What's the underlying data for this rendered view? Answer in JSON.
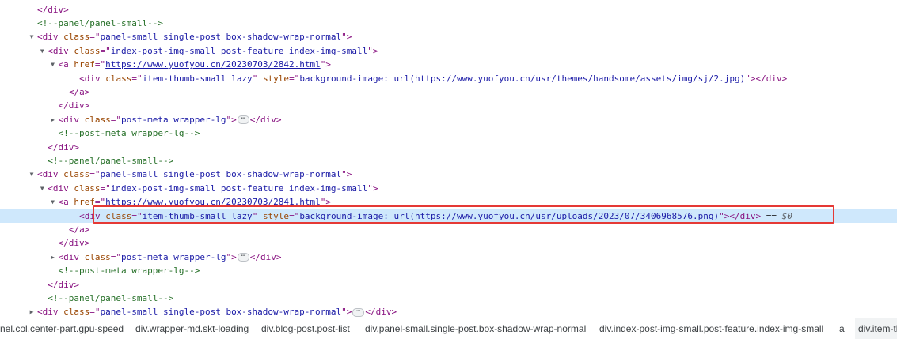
{
  "lines": [
    {
      "ind": 6,
      "tri": "",
      "tokens": [
        {
          "t": "tag",
          "v": "</div>"
        }
      ]
    },
    {
      "ind": 6,
      "tri": "",
      "tokens": [
        {
          "t": "cmt",
          "v": "<!--panel/panel-small-->"
        }
      ]
    },
    {
      "ind": 6,
      "tri": "open",
      "tokens": [
        {
          "t": "tag",
          "v": "<div "
        },
        {
          "t": "attr",
          "v": "class"
        },
        {
          "t": "tag",
          "v": "=\""
        },
        {
          "t": "val",
          "v": "panel-small single-post box-shadow-wrap-normal"
        },
        {
          "t": "tag",
          "v": "\">"
        }
      ]
    },
    {
      "ind": 8,
      "tri": "open",
      "tokens": [
        {
          "t": "tag",
          "v": "<div "
        },
        {
          "t": "attr",
          "v": "class"
        },
        {
          "t": "tag",
          "v": "=\""
        },
        {
          "t": "val",
          "v": "index-post-img-small post-feature index-img-small"
        },
        {
          "t": "tag",
          "v": "\">"
        }
      ]
    },
    {
      "ind": 10,
      "tri": "open",
      "tokens": [
        {
          "t": "tag",
          "v": "<a "
        },
        {
          "t": "attr",
          "v": "href"
        },
        {
          "t": "tag",
          "v": "=\""
        },
        {
          "t": "link",
          "v": "https://www.yuofyou.cn/20230703/2842.html"
        },
        {
          "t": "tag",
          "v": "\">"
        }
      ]
    },
    {
      "ind": 14,
      "tri": "",
      "tokens": [
        {
          "t": "tag",
          "v": "<div "
        },
        {
          "t": "attr",
          "v": "class"
        },
        {
          "t": "tag",
          "v": "=\""
        },
        {
          "t": "val",
          "v": "item-thumb-small lazy"
        },
        {
          "t": "tag",
          "v": "\" "
        },
        {
          "t": "attr",
          "v": "style"
        },
        {
          "t": "tag",
          "v": "=\""
        },
        {
          "t": "val",
          "v": "background-image: url(https://www.yuofyou.cn/usr/themes/handsome/assets/img/sj/2.jpg)"
        },
        {
          "t": "tag",
          "v": "\"></div>"
        }
      ]
    },
    {
      "ind": 12,
      "tri": "",
      "tokens": [
        {
          "t": "tag",
          "v": "</a>"
        }
      ]
    },
    {
      "ind": 10,
      "tri": "",
      "tokens": [
        {
          "t": "tag",
          "v": "</div>"
        }
      ]
    },
    {
      "ind": 10,
      "tri": "closed",
      "tokens": [
        {
          "t": "tag",
          "v": "<div "
        },
        {
          "t": "attr",
          "v": "class"
        },
        {
          "t": "tag",
          "v": "=\""
        },
        {
          "t": "val",
          "v": "post-meta wrapper-lg"
        },
        {
          "t": "tag",
          "v": "\">"
        },
        {
          "t": "ellipsis",
          "v": "⋯"
        },
        {
          "t": "tag",
          "v": "</div>"
        }
      ]
    },
    {
      "ind": 10,
      "tri": "",
      "tokens": [
        {
          "t": "cmt",
          "v": "<!--post-meta wrapper-lg-->"
        }
      ]
    },
    {
      "ind": 8,
      "tri": "",
      "tokens": [
        {
          "t": "tag",
          "v": "</div>"
        }
      ]
    },
    {
      "ind": 8,
      "tri": "",
      "tokens": [
        {
          "t": "cmt",
          "v": "<!--panel/panel-small-->"
        }
      ]
    },
    {
      "ind": 6,
      "tri": "open",
      "tokens": [
        {
          "t": "tag",
          "v": "<div "
        },
        {
          "t": "attr",
          "v": "class"
        },
        {
          "t": "tag",
          "v": "=\""
        },
        {
          "t": "val",
          "v": "panel-small single-post box-shadow-wrap-normal"
        },
        {
          "t": "tag",
          "v": "\">"
        }
      ]
    },
    {
      "ind": 8,
      "tri": "open",
      "tokens": [
        {
          "t": "tag",
          "v": "<div "
        },
        {
          "t": "attr",
          "v": "class"
        },
        {
          "t": "tag",
          "v": "=\""
        },
        {
          "t": "val",
          "v": "index-post-img-small post-feature index-img-small"
        },
        {
          "t": "tag",
          "v": "\">"
        }
      ]
    },
    {
      "ind": 10,
      "tri": "open",
      "tokens": [
        {
          "t": "tag",
          "v": "<a "
        },
        {
          "t": "attr",
          "v": "href"
        },
        {
          "t": "tag",
          "v": "=\""
        },
        {
          "t": "link",
          "v": "https://www.yuofyou.cn/20230703/2841.html"
        },
        {
          "t": "tag",
          "v": "\">"
        }
      ]
    },
    {
      "ind": 14,
      "tri": "",
      "selected": true,
      "tokens": [
        {
          "t": "tag",
          "v": "<div "
        },
        {
          "t": "attr",
          "v": "class"
        },
        {
          "t": "tag",
          "v": "=\""
        },
        {
          "t": "val",
          "v": "item-thumb-small lazy"
        },
        {
          "t": "tag",
          "v": "\" "
        },
        {
          "t": "attr",
          "v": "style"
        },
        {
          "t": "tag",
          "v": "=\""
        },
        {
          "t": "val",
          "v": "background-image: url(https://www.yuofyou.cn/usr/uploads/2023/07/3406968576.png)"
        },
        {
          "t": "tag",
          "v": "\"></div>"
        },
        {
          "t": "eq",
          "v": " == "
        },
        {
          "t": "dollar",
          "v": "$0"
        }
      ]
    },
    {
      "ind": 12,
      "tri": "",
      "tokens": [
        {
          "t": "tag",
          "v": "</a>"
        }
      ]
    },
    {
      "ind": 10,
      "tri": "",
      "tokens": [
        {
          "t": "tag",
          "v": "</div>"
        }
      ]
    },
    {
      "ind": 10,
      "tri": "closed",
      "tokens": [
        {
          "t": "tag",
          "v": "<div "
        },
        {
          "t": "attr",
          "v": "class"
        },
        {
          "t": "tag",
          "v": "=\""
        },
        {
          "t": "val",
          "v": "post-meta wrapper-lg"
        },
        {
          "t": "tag",
          "v": "\">"
        },
        {
          "t": "ellipsis",
          "v": "⋯"
        },
        {
          "t": "tag",
          "v": "</div>"
        }
      ]
    },
    {
      "ind": 10,
      "tri": "",
      "tokens": [
        {
          "t": "cmt",
          "v": "<!--post-meta wrapper-lg-->"
        }
      ]
    },
    {
      "ind": 8,
      "tri": "",
      "tokens": [
        {
          "t": "tag",
          "v": "</div>"
        }
      ]
    },
    {
      "ind": 8,
      "tri": "",
      "tokens": [
        {
          "t": "cmt",
          "v": "<!--panel/panel-small-->"
        }
      ]
    },
    {
      "ind": 6,
      "tri": "closed",
      "tokens": [
        {
          "t": "tag",
          "v": "<div "
        },
        {
          "t": "attr",
          "v": "class"
        },
        {
          "t": "tag",
          "v": "=\""
        },
        {
          "t": "val",
          "v": "panel-small single-post box-shadow-wrap-normal"
        },
        {
          "t": "tag",
          "v": "\">"
        },
        {
          "t": "ellipsis",
          "v": "⋯"
        },
        {
          "t": "tag",
          "v": "</div>"
        }
      ]
    }
  ],
  "breadcrumb": [
    "nel.col.center-part.gpu-speed",
    "div.wrapper-md.skt-loading",
    "div.blog-post.post-list",
    "div.panel-small.single-post.box-shadow-wrap-normal",
    "div.index-post-img-small.post-feature.index-img-small",
    "a",
    "div.item-th"
  ],
  "colors": {
    "tag": "#881280",
    "attr": "#994500",
    "value": "#1a1aa6",
    "comment": "#236e25",
    "selected_row": "#cfe8fc",
    "highlight_box": "#e53935"
  }
}
